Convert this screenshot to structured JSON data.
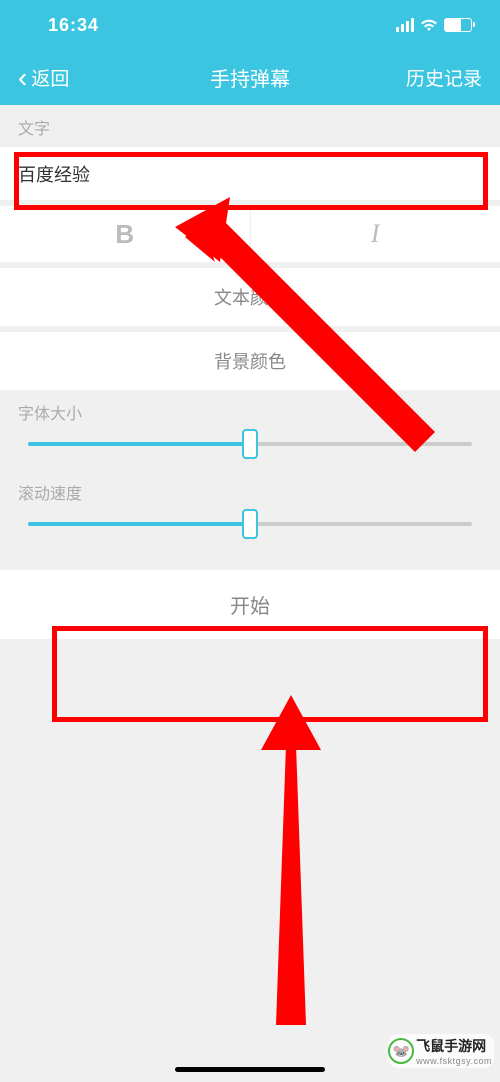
{
  "status": {
    "time": "16:34"
  },
  "nav": {
    "back": "返回",
    "title": "手持弹幕",
    "history": "历史记录"
  },
  "sections": {
    "text_label": "文字",
    "text_value": "百度经验",
    "bold_label": "B",
    "italic_label": "I",
    "text_color": "文本颜色",
    "bg_color": "背景颜色",
    "font_size_label": "字体大小",
    "scroll_speed_label": "滚动速度",
    "start": "开始"
  },
  "sliders": {
    "font_size": 50,
    "scroll_speed": 50
  },
  "watermark": {
    "name": "飞鼠手游网",
    "url": "www.fsktgsy.com"
  },
  "colors": {
    "accent": "#3cc5e0",
    "annotation": "#ff0000"
  }
}
